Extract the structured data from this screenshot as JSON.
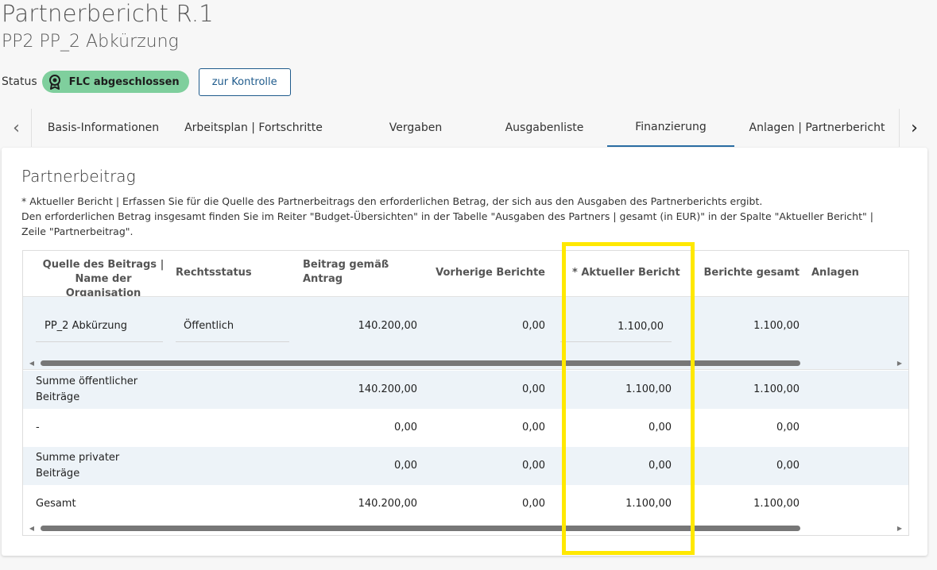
{
  "header": {
    "title": "Partnerbericht R.1",
    "subtitle": "PP2 PP_2 Abkürzung"
  },
  "status": {
    "label": "Status",
    "badge": "FLC abgeschlossen",
    "badge_color": "#7fcf9d",
    "badge_icon": "award-icon",
    "button": "zur Kontrolle"
  },
  "tabs": [
    {
      "label": "Basis-Informationen"
    },
    {
      "label": "Arbeitsplan | Fortschritte"
    },
    {
      "label": "Vergaben"
    },
    {
      "label": "Ausgabenliste"
    },
    {
      "label": "Finanzierung",
      "active": true
    },
    {
      "label": "Anlagen | Partnerbericht"
    }
  ],
  "section": {
    "title": "Partnerbeitrag",
    "desc_line1": "* Aktueller Bericht | Erfassen Sie für die Quelle des Partnerbeitrags den erforderlichen Betrag, der sich aus den Ausgaben des Partnerberichts ergibt.",
    "desc_line2": "Den erforderlichen Betrag insgesamt finden Sie im Reiter \"Budget-Übersichten\" in der Tabelle \"Ausgaben des Partners | gesamt (in EUR)\" in der Spalte \"Aktueller Bericht\" |",
    "desc_line3": "Zeile \"Partnerbeitrag\"."
  },
  "table": {
    "headers": {
      "source_line1": "Quelle des Beitrags |",
      "source_line2": "Name der Organisation",
      "legal": "Rechtsstatus",
      "amount_line1": "Beitrag gemäß",
      "amount_line2": "Antrag",
      "previous": "Vorherige Berichte",
      "current": "* Aktueller Bericht",
      "total": "Berichte gesamt",
      "attachments": "Anlagen"
    },
    "row": {
      "source": "PP_2 Abkürzung",
      "legal": "Öffentlich",
      "amount": "140.200,00",
      "previous": "0,00",
      "current": "1.100,00",
      "total": "1.100,00"
    },
    "summary": [
      {
        "label_line1": "Summe öffentlicher",
        "label_line2": "Beiträge",
        "amount": "140.200,00",
        "previous": "0,00",
        "current": "1.100,00",
        "total": "1.100,00"
      },
      {
        "label_line1": "-",
        "label_line2": "",
        "amount": "0,00",
        "previous": "0,00",
        "current": "0,00",
        "total": "0,00"
      },
      {
        "label_line1": "Summe privater",
        "label_line2": "Beiträge",
        "amount": "0,00",
        "previous": "0,00",
        "current": "0,00",
        "total": "0,00"
      },
      {
        "label_line1": "Gesamt",
        "label_line2": "",
        "amount": "140.200,00",
        "previous": "0,00",
        "current": "1.100,00",
        "total": "1.100,00"
      }
    ]
  },
  "colors": {
    "accent": "#2a6da3",
    "highlight": "#ffe800",
    "row_tint": "#edf3f8"
  }
}
